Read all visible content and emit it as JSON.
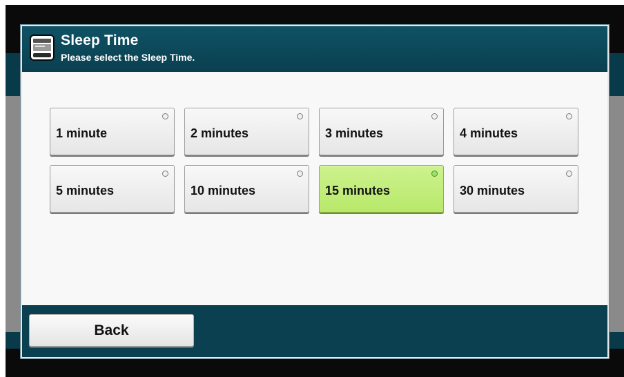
{
  "dialog": {
    "title": "Sleep Time",
    "subtitle": "Please select the Sleep Time.",
    "icon": "printer-icon"
  },
  "options": [
    {
      "label": "1 minute",
      "selected": false
    },
    {
      "label": "2 minutes",
      "selected": false
    },
    {
      "label": "3 minutes",
      "selected": false
    },
    {
      "label": "4 minutes",
      "selected": false
    },
    {
      "label": "5 minutes",
      "selected": false
    },
    {
      "label": "10 minutes",
      "selected": false
    },
    {
      "label": "15 minutes",
      "selected": true
    },
    {
      "label": "30 minutes",
      "selected": false
    }
  ],
  "footer": {
    "back_label": "Back"
  },
  "colors": {
    "header": "#0a4050",
    "selected": "#c0ec78",
    "button": "#eeeeee"
  }
}
